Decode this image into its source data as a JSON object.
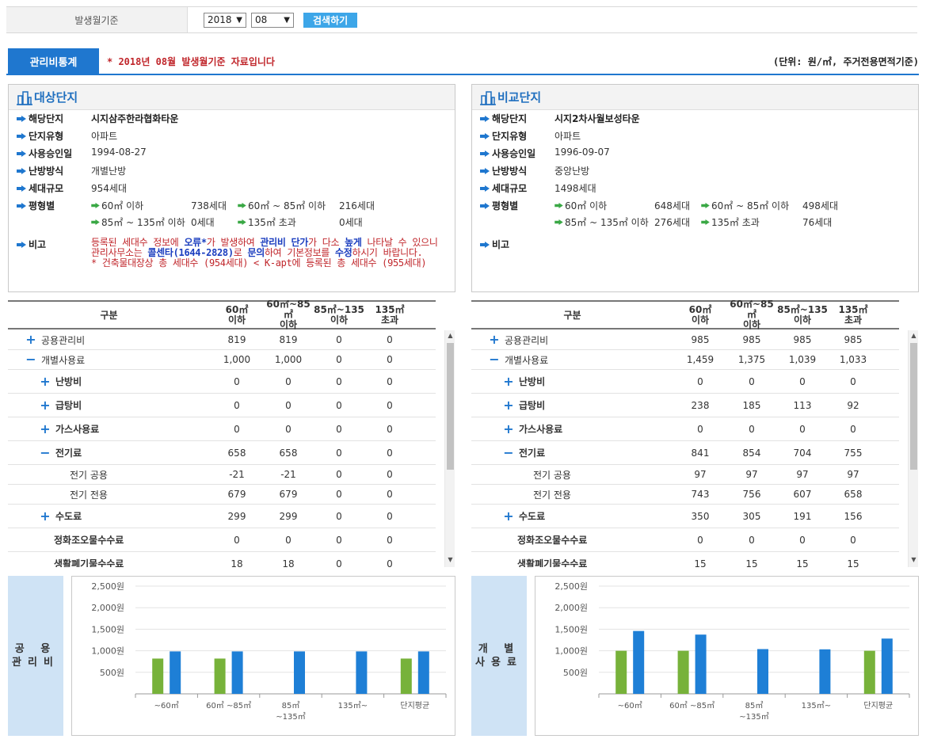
{
  "search": {
    "label": "발생월기준",
    "year": "2018",
    "month": "08",
    "button": "검색하기"
  },
  "stats": {
    "tab": "관리비통계",
    "note": "* 2018년 08월 발생월기준 자료입니다",
    "unit": "(단위: 원/㎡, 주거전용면적기준)"
  },
  "target": {
    "title": "대상단지",
    "rows": [
      {
        "key": "해당단지",
        "value": "시지삼주한라협화타운",
        "bold": true
      },
      {
        "key": "단지유형",
        "value": "아파트"
      },
      {
        "key": "사용승인일",
        "value": "1994-08-27"
      },
      {
        "key": "난방방식",
        "value": "개별난방"
      },
      {
        "key": "세대규모",
        "value": "954세대"
      }
    ],
    "size_key": "평형별",
    "sizes": [
      {
        "label": "60㎡ 이하",
        "count": "738세대"
      },
      {
        "label": "60㎡ ~ 85㎡ 이하",
        "count": "216세대"
      },
      {
        "label": "85㎡ ~ 135㎡ 이하",
        "count": "0세대"
      },
      {
        "label": "135㎡ 초과",
        "count": "0세대"
      }
    ],
    "remark_key": "비고",
    "remark": {
      "p1": "등록된 세대수 정보에 ",
      "b1": "오류*",
      "p2": "가 발생하여 ",
      "b2": "관리비 단가",
      "p3": "가 다소 ",
      "b3": "높게",
      "p4": " 나타날 수 있으니 관리사무소는 ",
      "b4": "콜센타(1644-2828)",
      "p5": "로 ",
      "b5": "문의",
      "p6": "하여 기본정보를 ",
      "b6": "수정",
      "p7": "하시기 바랍니다.",
      "line2": "* 건축물대장상 총 세대수 (954세대) < K-apt에 등록된 총 세대수 (955세대)"
    }
  },
  "compare": {
    "title": "비교단지",
    "rows": [
      {
        "key": "해당단지",
        "value": "시지2차사월보성타운",
        "bold": true
      },
      {
        "key": "단지유형",
        "value": "아파트"
      },
      {
        "key": "사용승인일",
        "value": "1996-09-07"
      },
      {
        "key": "난방방식",
        "value": "중앙난방"
      },
      {
        "key": "세대규모",
        "value": "1498세대"
      }
    ],
    "size_key": "평형별",
    "sizes": [
      {
        "label": "60㎡ 이하",
        "count": "648세대"
      },
      {
        "label": "60㎡ ~ 85㎡ 이하",
        "count": "498세대"
      },
      {
        "label": "85㎡ ~ 135㎡ 이하",
        "count": "276세대"
      },
      {
        "label": "135㎡ 초과",
        "count": "76세대"
      }
    ],
    "remark_key": "비고"
  },
  "table_header": {
    "category": "구분",
    "cols": [
      [
        "60㎡",
        "이하"
      ],
      [
        "60㎡~85㎡",
        "이하"
      ],
      [
        "85㎡~135",
        "이하"
      ],
      [
        "135㎡",
        "초과"
      ]
    ]
  },
  "target_table": [
    {
      "name": "공용관리비",
      "icon": "+",
      "indent": 0,
      "bold": false,
      "h": 25,
      "vals": [
        "819",
        "819",
        "0",
        "0"
      ]
    },
    {
      "name": "개별사용료",
      "icon": "−",
      "indent": 0,
      "bold": false,
      "h": 25,
      "vals": [
        "1,000",
        "1,000",
        "0",
        "0"
      ]
    },
    {
      "name": "난방비",
      "icon": "+",
      "indent": 1,
      "bold": true,
      "h": 30,
      "vals": [
        "0",
        "0",
        "0",
        "0"
      ]
    },
    {
      "name": "급탕비",
      "icon": "+",
      "indent": 1,
      "bold": true,
      "h": 30,
      "vals": [
        "0",
        "0",
        "0",
        "0"
      ]
    },
    {
      "name": "가스사용료",
      "icon": "+",
      "indent": 1,
      "bold": true,
      "h": 30,
      "vals": [
        "0",
        "0",
        "0",
        "0"
      ]
    },
    {
      "name": "전기료",
      "icon": "−",
      "indent": 1,
      "bold": true,
      "h": 30,
      "vals": [
        "658",
        "658",
        "0",
        "0"
      ]
    },
    {
      "name": "전기 공용",
      "icon": "",
      "indent": 2,
      "bold": false,
      "h": 25,
      "vals": [
        "-21",
        "-21",
        "0",
        "0"
      ]
    },
    {
      "name": "전기 전용",
      "icon": "",
      "indent": 2,
      "bold": false,
      "h": 25,
      "vals": [
        "679",
        "679",
        "0",
        "0"
      ]
    },
    {
      "name": "수도료",
      "icon": "+",
      "indent": 1,
      "bold": true,
      "h": 30,
      "vals": [
        "299",
        "299",
        "0",
        "0"
      ]
    },
    {
      "name": "정화조오물수수료",
      "icon": "",
      "indent": 3,
      "bold": true,
      "h": 30,
      "vals": [
        "0",
        "0",
        "0",
        "0"
      ]
    },
    {
      "name": "생활폐기물수수료",
      "icon": "",
      "indent": 3,
      "bold": true,
      "h": 30,
      "vals": [
        "18",
        "18",
        "0",
        "0"
      ]
    }
  ],
  "compare_table": [
    {
      "name": "공용관리비",
      "icon": "+",
      "indent": 0,
      "bold": false,
      "h": 25,
      "vals": [
        "985",
        "985",
        "985",
        "985"
      ]
    },
    {
      "name": "개별사용료",
      "icon": "−",
      "indent": 0,
      "bold": false,
      "h": 25,
      "vals": [
        "1,459",
        "1,375",
        "1,039",
        "1,033"
      ]
    },
    {
      "name": "난방비",
      "icon": "+",
      "indent": 1,
      "bold": true,
      "h": 30,
      "vals": [
        "0",
        "0",
        "0",
        "0"
      ]
    },
    {
      "name": "급탕비",
      "icon": "+",
      "indent": 1,
      "bold": true,
      "h": 30,
      "vals": [
        "238",
        "185",
        "113",
        "92"
      ]
    },
    {
      "name": "가스사용료",
      "icon": "+",
      "indent": 1,
      "bold": true,
      "h": 30,
      "vals": [
        "0",
        "0",
        "0",
        "0"
      ]
    },
    {
      "name": "전기료",
      "icon": "−",
      "indent": 1,
      "bold": true,
      "h": 30,
      "vals": [
        "841",
        "854",
        "704",
        "755"
      ]
    },
    {
      "name": "전기 공용",
      "icon": "",
      "indent": 2,
      "bold": false,
      "h": 25,
      "vals": [
        "97",
        "97",
        "97",
        "97"
      ]
    },
    {
      "name": "전기 전용",
      "icon": "",
      "indent": 2,
      "bold": false,
      "h": 25,
      "vals": [
        "743",
        "756",
        "607",
        "658"
      ]
    },
    {
      "name": "수도료",
      "icon": "+",
      "indent": 1,
      "bold": true,
      "h": 30,
      "vals": [
        "350",
        "305",
        "191",
        "156"
      ]
    },
    {
      "name": "정화조오물수수료",
      "icon": "",
      "indent": 3,
      "bold": true,
      "h": 30,
      "vals": [
        "0",
        "0",
        "0",
        "0"
      ]
    },
    {
      "name": "생활폐기물수수료",
      "icon": "",
      "indent": 3,
      "bold": true,
      "h": 30,
      "vals": [
        "15",
        "15",
        "15",
        "15"
      ]
    }
  ],
  "chart_labels": {
    "left": [
      "공 용",
      "관리비"
    ],
    "right": [
      "개 별",
      "사용료"
    ]
  },
  "colors": {
    "green": "#77b23a",
    "blue": "#1e7fd6",
    "accent": "#1f77cf"
  },
  "chart_data": [
    {
      "type": "bar",
      "categories": [
        [
          "~60㎡"
        ],
        [
          "60㎡ ~85㎡"
        ],
        [
          "85㎡",
          "~135㎡"
        ],
        [
          "135㎡~"
        ],
        [
          "단지평균"
        ]
      ],
      "series": [
        {
          "values": [
            819,
            819,
            0,
            0,
            819
          ]
        },
        {
          "values": [
            985,
            985,
            985,
            985,
            985
          ]
        }
      ],
      "yticks": [
        500,
        1000,
        1500,
        2000,
        2500
      ],
      "ytick_labels": [
        "500원",
        "1,000원",
        "1,500원",
        "2,000원",
        "2,500원"
      ],
      "ylim": [
        0,
        2500
      ],
      "grid": "horizontal"
    },
    {
      "type": "bar",
      "categories": [
        [
          "~60㎡"
        ],
        [
          "60㎡ ~85㎡"
        ],
        [
          "85㎡",
          "~135㎡"
        ],
        [
          "135㎡~"
        ],
        [
          "단지평균"
        ]
      ],
      "series": [
        {
          "values": [
            1000,
            1000,
            0,
            0,
            1000
          ]
        },
        {
          "values": [
            1459,
            1375,
            1039,
            1033,
            1283
          ]
        }
      ],
      "yticks": [
        500,
        1000,
        1500,
        2000,
        2500
      ],
      "ytick_labels": [
        "500원",
        "1,000원",
        "1,500원",
        "2,000원",
        "2,500원"
      ],
      "ylim": [
        0,
        2500
      ],
      "grid": "horizontal"
    }
  ]
}
